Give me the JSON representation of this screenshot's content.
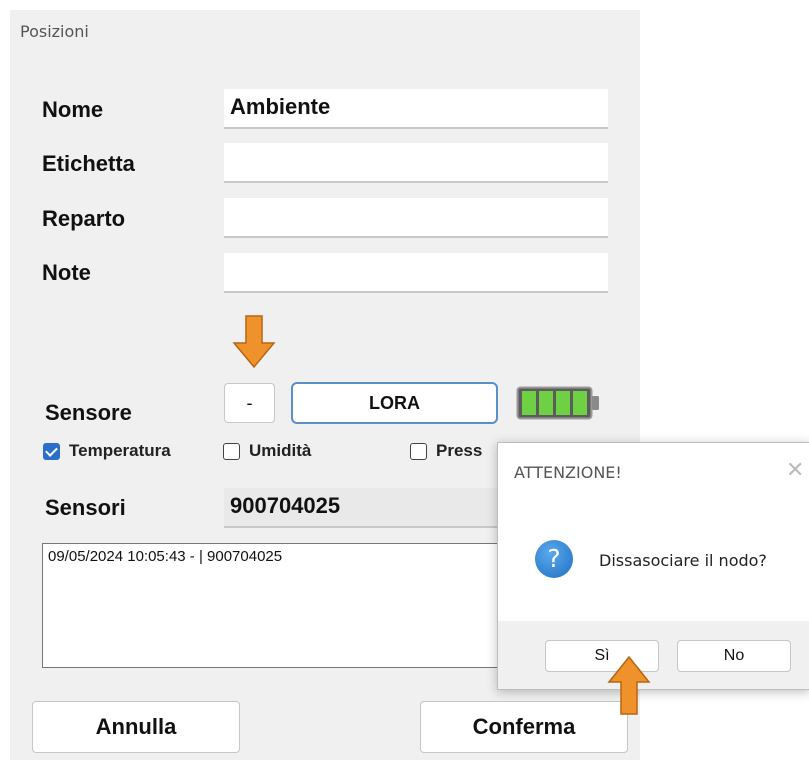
{
  "window": {
    "title": "Posizioni"
  },
  "form": {
    "nome_label": "Nome",
    "nome_value": "Ambiente",
    "etichetta_label": "Etichetta",
    "etichetta_value": "",
    "reparto_label": "Reparto",
    "reparto_value": "",
    "note_label": "Note",
    "note_value": ""
  },
  "sensor": {
    "label": "Sensore",
    "minus_label": "-",
    "type_label": "LORA",
    "battery_icon": "battery-full-icon",
    "battery_level": 1.0
  },
  "checkboxes": [
    {
      "label": "Temperatura",
      "checked": true
    },
    {
      "label": "Umidità",
      "checked": false
    },
    {
      "label": "Press",
      "checked": false
    }
  ],
  "sensori": {
    "label": "Sensori",
    "value": "900704025"
  },
  "log": {
    "lines": [
      "09/05/2024 10:05:43 -  | 900704025"
    ]
  },
  "buttons": {
    "annulla": "Annulla",
    "conferma": "Conferma"
  },
  "dialog": {
    "title": "ATTENZIONE!",
    "message": "Dissasociare il nodo?",
    "icon": "question-icon",
    "yes_label": "Sì",
    "no_label": "No"
  },
  "annotations": {
    "arrow_color": "#f0922b"
  }
}
